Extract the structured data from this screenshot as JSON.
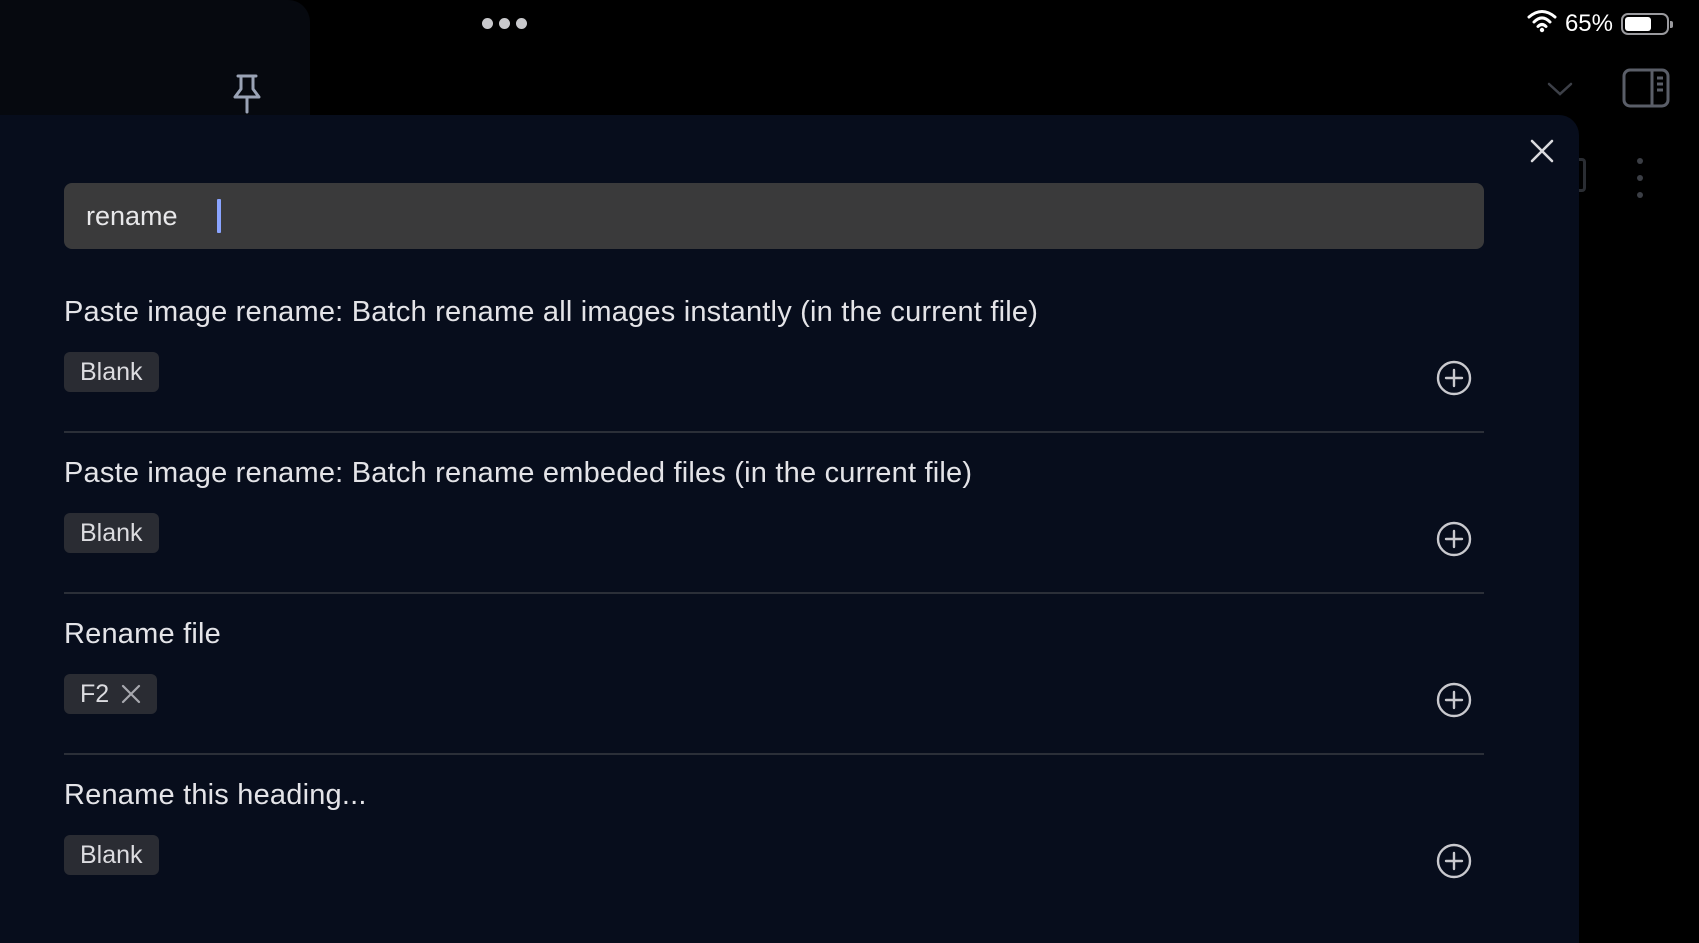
{
  "status_bar": {
    "battery_percent_label": "65%",
    "battery_level": 0.65
  },
  "header": {
    "pin_icon": "pin-icon",
    "chevron_icon": "chevron-down-icon",
    "sidebar_icon": "right-sidebar-toggle-icon",
    "more_icon": "more-vertical-icon"
  },
  "modal": {
    "close_icon": "close-icon",
    "search": {
      "value": "rename"
    },
    "commands": [
      {
        "title": "Paste image rename: Batch rename all images instantly (in the current file)",
        "hotkeys": [
          "Blank"
        ],
        "removable": false
      },
      {
        "title": "Paste image rename: Batch rename embeded files (in the current file)",
        "hotkeys": [
          "Blank"
        ],
        "removable": false
      },
      {
        "title": "Rename file",
        "hotkeys": [
          "F2"
        ],
        "removable": true
      },
      {
        "title": "Rename this heading...",
        "hotkeys": [
          "Blank"
        ],
        "removable": false
      }
    ]
  },
  "colors": {
    "modal_bg": "#070d1c",
    "search_bg": "#3a3a3b",
    "chip_bg": "#2a2c33",
    "caret": "#8aa4ff",
    "divider": "#2b2f38"
  }
}
